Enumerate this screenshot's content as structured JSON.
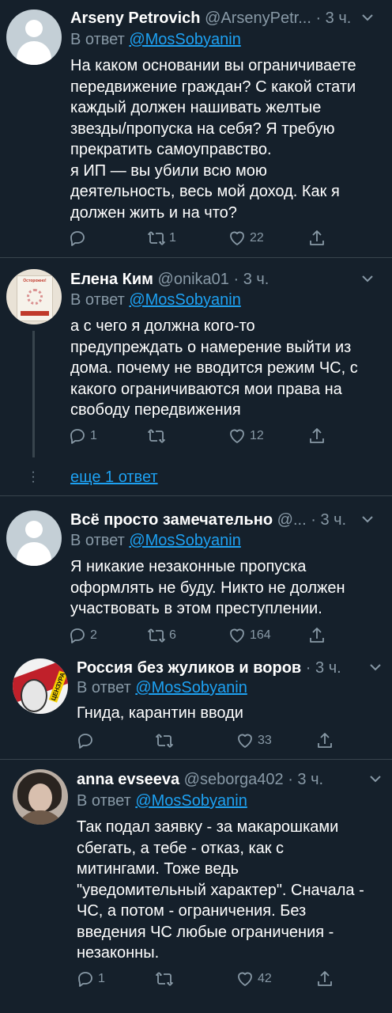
{
  "tweets": [
    {
      "name": "Arseny Petrovich",
      "handle": "@ArsenyPetr...",
      "time": "3 ч.",
      "reply_prefix": "В ответ",
      "reply_to": "@MosSobyanin",
      "text": "На каком основании вы ограничиваете\nпередвижение граждан? С какой стати\nкаждый должен нашивать желтые\nзвезды/пропуска на себя? Я требую\nпрекратить самоуправство.\nя ИП — вы убили всю мою\nдеятельность, весь мой доход. Как я\nдолжен жить и на что?",
      "replies": "",
      "retweets": "1",
      "likes": "22",
      "avatar": "default-avatar"
    },
    {
      "name": "Елена Ким",
      "handle": "@onika01",
      "time": "3 ч.",
      "reply_prefix": "В ответ",
      "reply_to": "@MosSobyanin",
      "text": "а с чего я должна кого-то\nпредупреждать о намерение выйти из\nдома. почему не вводится режим ЧС, с\nкакого ограничиваются мои права на\nсвободу передвижения",
      "replies": "1",
      "retweets": "",
      "likes": "12",
      "avatar": "poster-avatar",
      "avatar_text": "Осторожно!"
    },
    {
      "name": "Всё просто замечательно",
      "handle": "@...",
      "time": "3 ч.",
      "reply_prefix": "В ответ",
      "reply_to": "@MosSobyanin",
      "text": "Я никакие незаконные пропуска\nоформлять не буду. Никто не должен\nучаствовать в этом преступлении.",
      "replies": "2",
      "retweets": "6",
      "likes": "164",
      "avatar": "default-avatar"
    },
    {
      "name": "Россия без жуликов и воров",
      "handle": "",
      "time": "3 ч.",
      "reply_prefix": "В ответ",
      "reply_to": "@MosSobyanin",
      "text": "Гнида, карантин вводи",
      "replies": "",
      "retweets": "",
      "likes": "33",
      "avatar": "censor-avatar",
      "avatar_text": "ЦЕНЗУРА"
    },
    {
      "name": "anna evseeva",
      "handle": "@seborga402",
      "time": "3 ч.",
      "reply_prefix": "В ответ",
      "reply_to": "@MosSobyanin",
      "text": "Так подал заявку - за макарошками\nсбегать, а тебе - отказ, как с\nмитингами.  Тоже ведь\n\"уведомительный характер\". Сначала -\nЧС, а потом - ограничения. Без\nвведения ЧС любые ограничения -\nнезаконны.",
      "replies": "1",
      "retweets": "",
      "likes": "42",
      "avatar": "photo-avatar"
    }
  ],
  "show_more": "еще 1 ответ",
  "colors": {
    "background": "#15202b",
    "secondary_text": "#8899a6",
    "link": "#1da1f2",
    "separator": "#38444d"
  }
}
